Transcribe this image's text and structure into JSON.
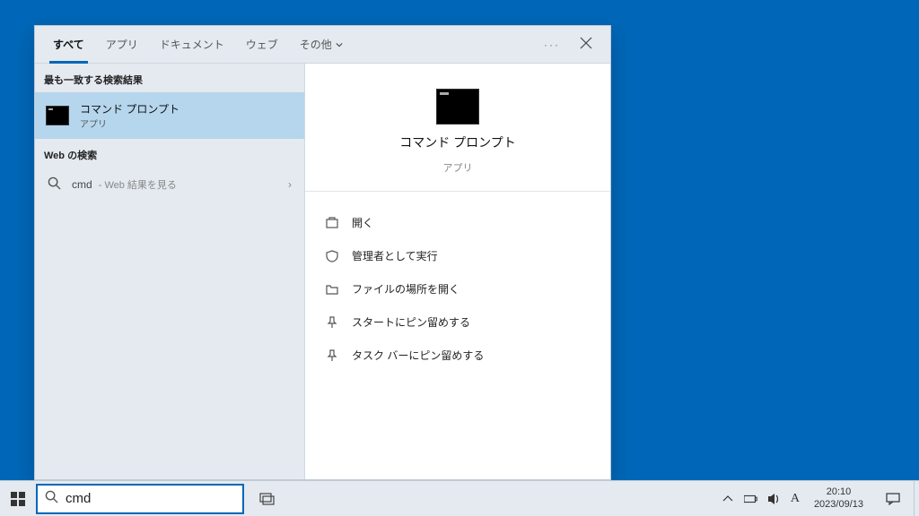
{
  "search": {
    "query": "cmd",
    "tabs": {
      "all": "すべて",
      "apps": "アプリ",
      "docs": "ドキュメント",
      "web": "ウェブ",
      "other": "その他"
    }
  },
  "results": {
    "best_match_header": "最も一致する検索結果",
    "best_match": {
      "title": "コマンド プロンプト",
      "subtitle": "アプリ"
    },
    "web_header": "Web の検索",
    "web_item": {
      "term": "cmd",
      "hint": " - Web 結果を見る"
    }
  },
  "preview": {
    "title": "コマンド プロンプト",
    "subtitle": "アプリ",
    "actions": {
      "open": "開く",
      "run_admin": "管理者として実行",
      "open_location": "ファイルの場所を開く",
      "pin_start": "スタートにピン留めする",
      "pin_taskbar": "タスク バーにピン留めする"
    }
  },
  "taskbar": {
    "ime": "A",
    "time": "20:10",
    "date": "2023/09/13"
  }
}
